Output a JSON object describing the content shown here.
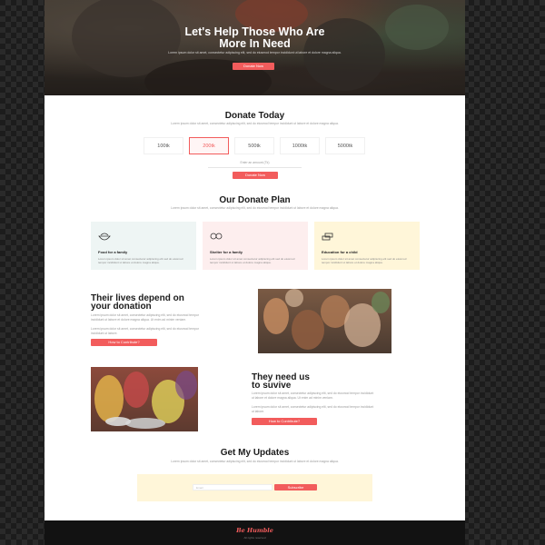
{
  "hero": {
    "title_line1": "Let's Help Those Who Are",
    "title_line2": "More In Need",
    "subtitle": "Lorem ipsum dolor sit amet, consectetur adipiscing elit, sed do eiusmod tempor incididunt ut labore et dolore magna aliqua.",
    "button": "Donate Now"
  },
  "donate": {
    "title": "Donate Today",
    "desc": "Lorem ipsum dolor sit amet, consectetur adipiscing elit, sed do eiusmod tempor incididunt ut labore et dolore magna aliqua.",
    "amounts": [
      "100tk",
      "200tk",
      "500tk",
      "1000tk",
      "5000tk"
    ],
    "selected_index": 1,
    "custom_label": "Enter an amount (Tk)",
    "button": "Donate Now"
  },
  "plan": {
    "title": "Our Donate Plan",
    "desc": "Lorem ipsum dolor sit amet, consectetur adipiscing elit, sed do eiusmod tempor incididunt ut labore et dolore magna aliqua.",
    "cards": [
      {
        "title": "Food for a family",
        "desc": "Lorem ipsum dolor sit amet consectetur adipiscing elit sed do eiusmod tempor incididunt ut labore et dolore magna aliqua.",
        "bg": "#eef5f4",
        "icon": "food-bowl-icon"
      },
      {
        "title": "Shelter for a family",
        "desc": "Lorem ipsum dolor sit amet consectetur adipiscing elit sed do eiusmod tempor incididunt ut labore et dolore magna aliqua.",
        "bg": "#fdeeee",
        "icon": "shelter-icon"
      },
      {
        "title": "Education for a child",
        "desc": "Lorem ipsum dolor sit amet consectetur adipiscing elit sed do eiusmod tempor incididunt ut labore et dolore magna aliqua.",
        "bg": "#fff6d9",
        "icon": "education-icon"
      }
    ]
  },
  "story1": {
    "title_line1": "Their lives depend on",
    "title_line2": "your donation",
    "para1": "Lorem ipsum dolor sit amet, consectetur adipiscing elit, sed do eiusmod tempor incididunt ut labore et dolore magna aliqua. Ut enim ad minim veniam.",
    "para2": "Lorem ipsum dolor sit amet, consectetur adipiscing elit, sed do eiusmod tempor incididunt ut labore.",
    "button": "How to Contribute?"
  },
  "story2": {
    "title_line1": "They need us",
    "title_line2": "to suvive",
    "para1": "Lorem ipsum dolor sit amet, consectetur adipiscing elit, sed do eiusmod tempor incididunt ut labore et dolore magna aliqua. Ut enim ad minim veniam.",
    "para2": "Lorem ipsum dolor sit amet, consectetur adipiscing elit, sed do eiusmod tempor incididunt ut labore.",
    "button": "How to Contribute?"
  },
  "updates": {
    "title": "Get My Updates",
    "desc": "Lorem ipsum dolor sit amet, consectetur adipiscing elit, sed do eiusmod tempor incididunt ut labore et dolore magna aliqua.",
    "email_placeholder": "Email",
    "button": "Subscribe"
  },
  "footer": {
    "brand": "Be Humble",
    "copyright": "All rights reserved"
  },
  "colors": {
    "accent": "#f25c5c",
    "dark": "#121212",
    "food_card": "#eef5f4",
    "shelter_card": "#fdeeee",
    "education_card": "#fff6d9"
  }
}
